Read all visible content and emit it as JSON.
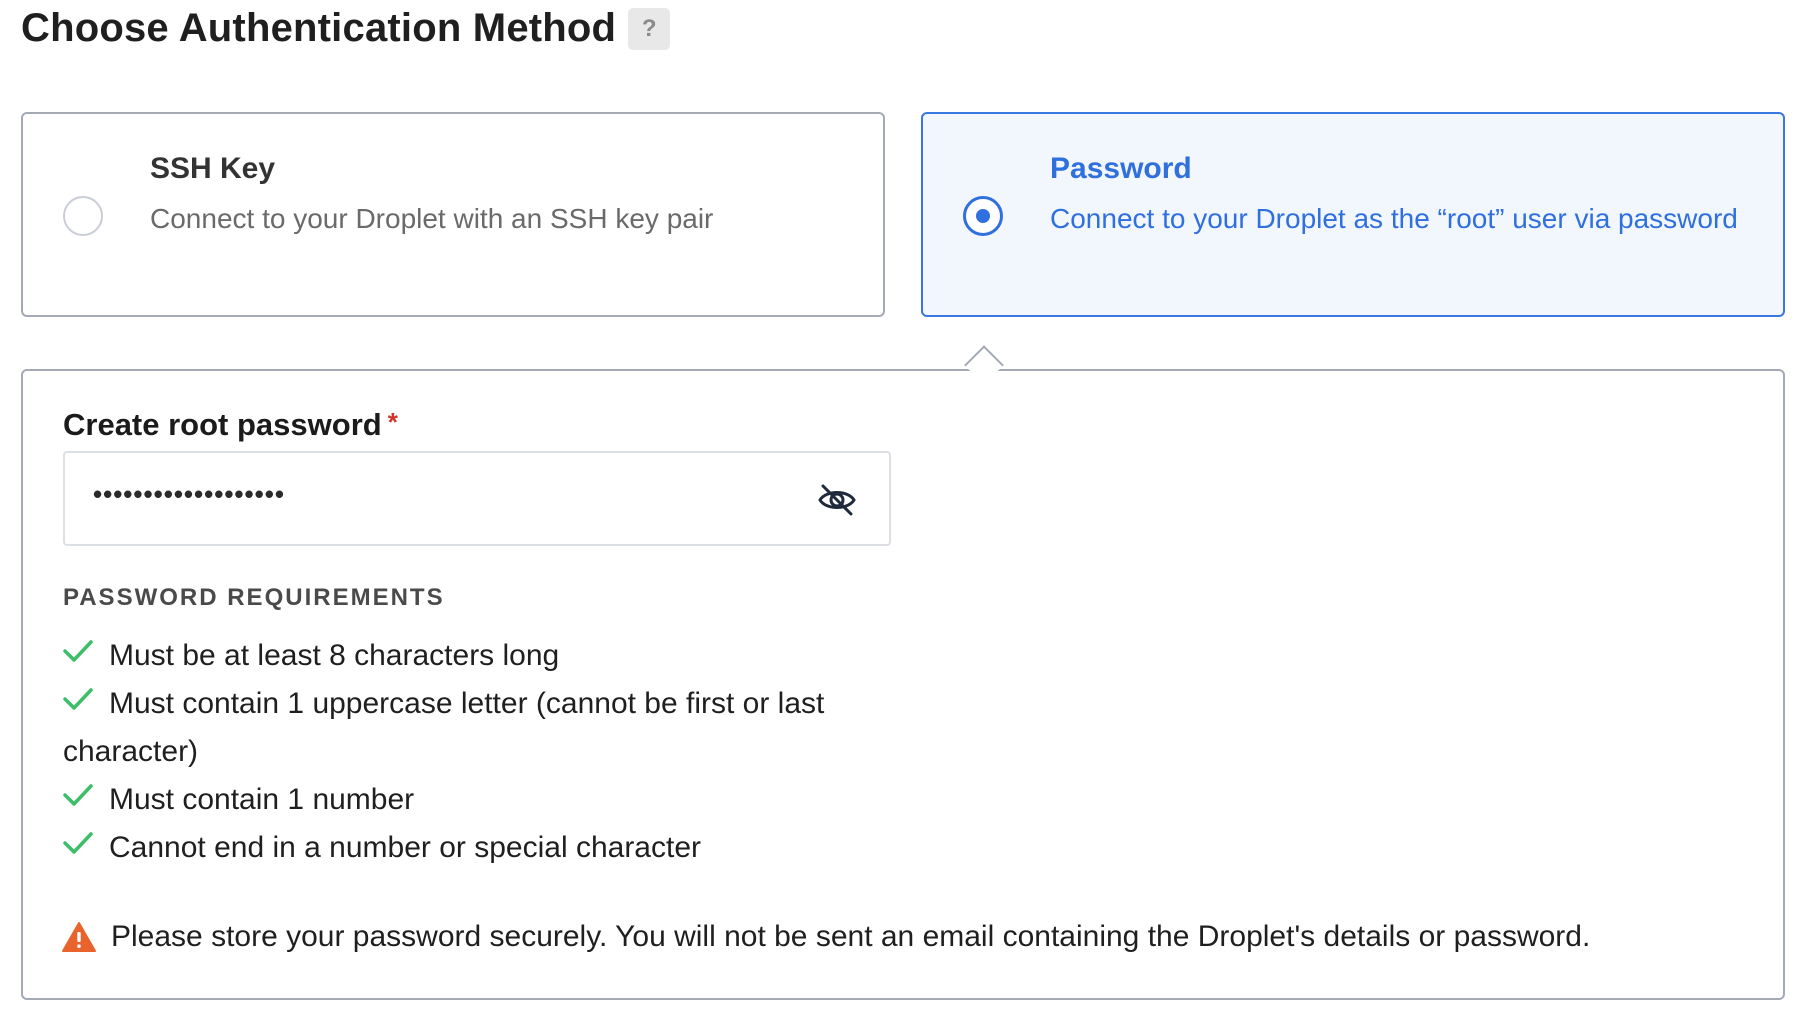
{
  "heading": {
    "title": "Choose Authentication Method",
    "help": "?"
  },
  "options": [
    {
      "title": "SSH Key",
      "description": "Connect to your Droplet with an SSH key pair",
      "selected": false
    },
    {
      "title": "Password",
      "description": "Connect to your Droplet as the “root” user via password",
      "selected": true
    }
  ],
  "password": {
    "label": "Create root password",
    "required_mark": "*",
    "masked_value": "•••••••••••••••••••",
    "requirements_title": "PASSWORD REQUIREMENTS",
    "requirements": [
      "Must be at least 8 characters long",
      "Must contain 1 uppercase letter (cannot be first or last character)",
      "Must contain 1 number",
      "Cannot end in a number or special character"
    ],
    "warning": "Please store your password securely. You will not be sent an email containing the Droplet's details or password."
  },
  "colors": {
    "accent": "#2f6fde",
    "check": "#3dbe6b",
    "warning": "#e8642c",
    "required": "#d0342c"
  }
}
